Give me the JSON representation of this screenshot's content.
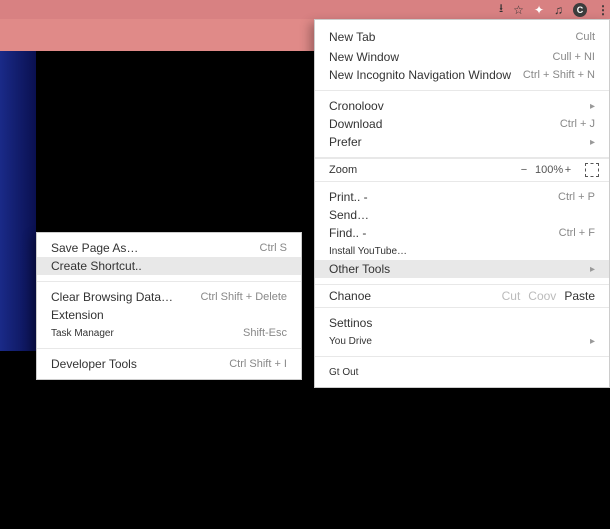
{
  "toolbar": {
    "avatar_letter": "C"
  },
  "menu": {
    "s1": [
      {
        "label": "New Tab",
        "shortcut": "Cult"
      },
      {
        "label": "New Window",
        "shortcut": "Cull + NI"
      },
      {
        "label": "New Incognito Navigation Window",
        "shortcut": "Ctrl + Shift + N"
      }
    ],
    "s2": [
      {
        "label": "Cronoloov",
        "arrow": true
      },
      {
        "label": "Download",
        "shortcut": "Ctrl + J"
      },
      {
        "label": "Prefer",
        "arrow": true
      }
    ],
    "zoom": {
      "label": "Zoom",
      "minus": "−",
      "value": "100%",
      "plus": "+"
    },
    "s3": [
      {
        "label": "Print.. -",
        "shortcut": "Ctrl + P"
      },
      {
        "label": "Send…"
      },
      {
        "label": "Find.. -",
        "shortcut": "Ctrl + F"
      },
      {
        "label": "Install YouTube…",
        "small": true
      },
      {
        "label": "Other Tools",
        "arrow": true,
        "hover": true
      }
    ],
    "edit": {
      "label": "Chanoe",
      "cut": "Cut",
      "copy": "Coov",
      "paste": "Paste"
    },
    "s4": [
      {
        "label": "Settinos"
      },
      {
        "label": "You Drive",
        "small": true,
        "arrow": true
      }
    ],
    "s5": [
      {
        "label": "Gt Out",
        "small": true
      }
    ]
  },
  "submenu": {
    "s1": [
      {
        "label": "Save Page As…",
        "shortcut": "Ctrl S"
      },
      {
        "label": "Create Shortcut..",
        "hover": true
      }
    ],
    "s2": [
      {
        "label": "Clear Browsing Data…",
        "shortcut": "Ctrl Shift + Delete"
      },
      {
        "label": "Extension"
      },
      {
        "label": "Task Manager",
        "shortcut": "Shift-Esc",
        "small": true
      }
    ],
    "s3": [
      {
        "label": "Developer Tools",
        "shortcut": "Ctrl Shift + I"
      }
    ]
  }
}
